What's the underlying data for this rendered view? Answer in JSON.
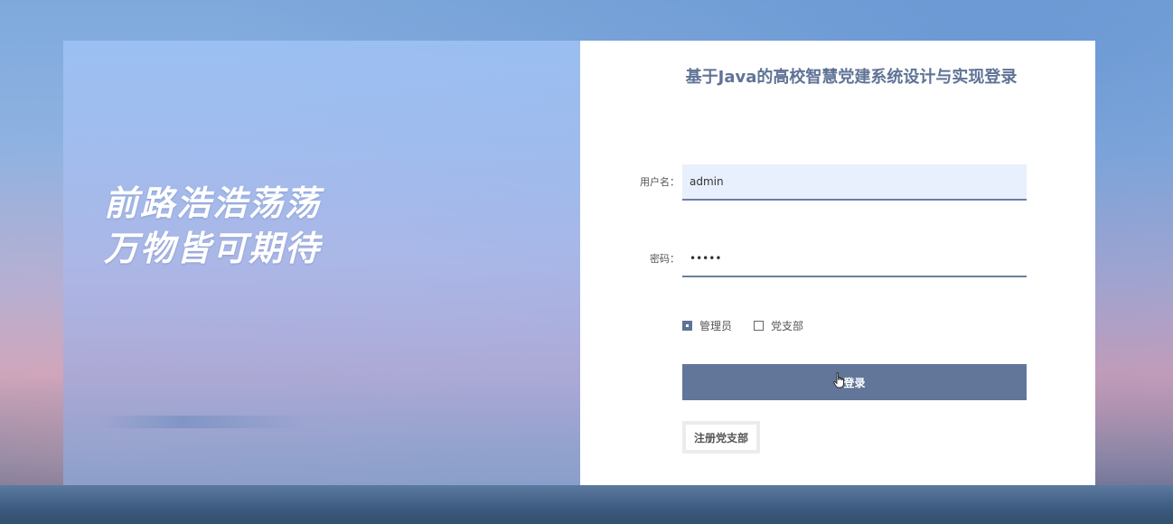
{
  "slogan": {
    "line1": "前路浩浩荡荡",
    "line2": "万物皆可期待"
  },
  "login": {
    "title": "基于Java的高校智慧党建系统设计与实现登录",
    "username_label": "用户名：",
    "username_value": "admin",
    "password_label": "密码：",
    "password_value": "•••••",
    "roles": [
      {
        "label": "管理员",
        "checked": true
      },
      {
        "label": "党支部",
        "checked": false
      }
    ],
    "login_button": "登录",
    "register_button": "注册党支部"
  },
  "colors": {
    "accent": "#62769a",
    "title": "#5f7396"
  },
  "icons": {
    "cursor": "hand-pointer-icon"
  }
}
